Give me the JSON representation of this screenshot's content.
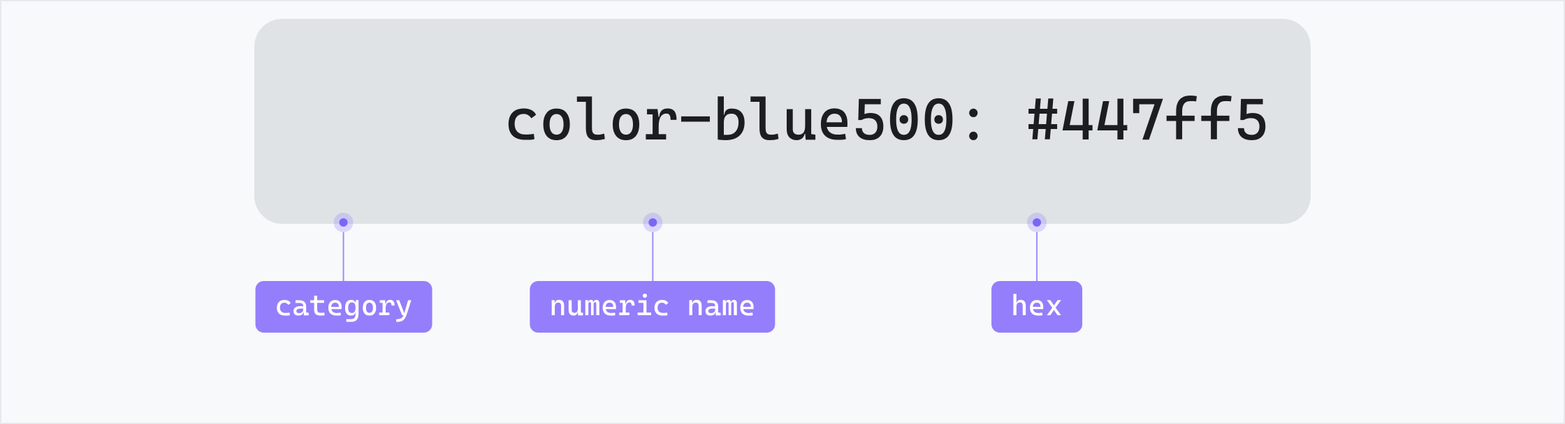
{
  "token": {
    "full_string": "color-blue500: #447ff5",
    "category_part": "color",
    "numeric_name_part": "blue500",
    "hex_part": "#447ff5"
  },
  "annotations": {
    "category": "category",
    "numeric_name": "numeric name",
    "hex": "hex"
  },
  "colors": {
    "pill_bg": "#dfe3e6",
    "frame_bg": "#f7f9fb",
    "frame_border": "#e7e9ec",
    "accent": "#947efc",
    "accent_dot": "#7a66f8",
    "text": "#1b1d1f"
  }
}
